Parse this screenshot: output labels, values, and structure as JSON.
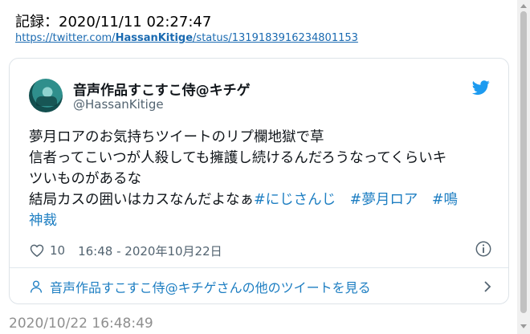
{
  "header": {
    "record_text": "記録：2020/11/11 02:27:47",
    "url_prefix": "https://twitter.com/",
    "url_user": "HassanKitige",
    "url_suffix": "/status/1319183916234801153"
  },
  "tweet": {
    "display_name": "音声作品すこすこ侍@キチゲ",
    "handle": "@HassanKitige",
    "lines": [
      "夢月ロアのお気持ちツイートのリプ欄地獄で草",
      "信者ってこいつが人殺しても擁護し続けるんだろうなってくらいキ",
      "ツいものがあるな",
      "結局カスの囲いはカスなんだよなぁ"
    ],
    "hashtags": [
      "#にじさんじ",
      "#夢月ロア",
      "#鳴",
      "神裁"
    ],
    "like_count": "10",
    "timestamp": "16:48 - 2020年10月22日",
    "more_tweets_label": "音声作品すこすこ侍@キチゲさんの他のツイートを見る"
  },
  "footer": {
    "saved_time": "2020/10/22 16:48:49"
  },
  "colors": {
    "link": "#1a6ab1",
    "hashtag": "#1d7ec2",
    "twitter_blue": "#1d9bf0",
    "muted": "#536471"
  },
  "icons": [
    "twitter-bird-icon",
    "heart-icon",
    "info-icon",
    "person-icon",
    "chevron-right-icon"
  ]
}
